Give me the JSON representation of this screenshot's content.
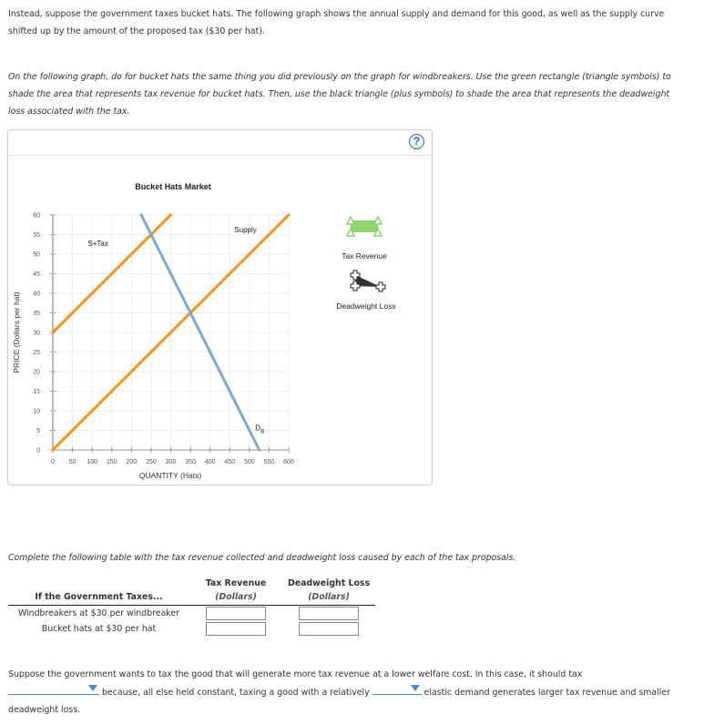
{
  "intro": {
    "paragraph1": "Instead, suppose the government taxes bucket hats. The following graph shows the annual supply and demand for this good, as well as the supply curve shifted up by the amount of the proposed tax ($30 per hat).",
    "paragraph2": "On the following graph, do for bucket hats the same thing you did previously on the graph for windbreakers. Use the green rectangle (triangle symbols) to shade the area that represents tax revenue for bucket hats. Then, use the black triangle (plus symbols) to shade the area that represents the deadweight loss associated with the tax."
  },
  "graph_panel": {
    "help_label": "?",
    "palette": {
      "tax_revenue_label": "Tax Revenue",
      "deadweight_loss_label": "Deadweight Loss",
      "tax_revenue_color": "#8ed36b",
      "deadweight_loss_color": "#333333"
    }
  },
  "chart_data": {
    "type": "line",
    "title": "Bucket Hats Market",
    "xlabel": "QUANTITY (Hats)",
    "ylabel": "PRICE (Dollars per hat)",
    "xlim": [
      0,
      600
    ],
    "ylim": [
      0,
      60
    ],
    "xticks": [
      0,
      50,
      100,
      150,
      200,
      250,
      300,
      350,
      400,
      450,
      500,
      550,
      600
    ],
    "yticks": [
      0,
      5,
      10,
      15,
      20,
      25,
      30,
      35,
      40,
      45,
      50,
      55,
      60
    ],
    "grid": true,
    "series": [
      {
        "name": "S+Tax",
        "label": "S+Tax",
        "color": "#f7941d",
        "points": [
          [
            0,
            30
          ],
          [
            300,
            60
          ]
        ]
      },
      {
        "name": "Supply",
        "label": "Supply",
        "color": "#f7941d",
        "points": [
          [
            0,
            0
          ],
          [
            600,
            60
          ]
        ]
      },
      {
        "name": "Demand",
        "label": "D",
        "label_sub": "B",
        "color": "#7ea9d4",
        "points": [
          [
            225,
            60
          ],
          [
            525,
            0
          ]
        ]
      }
    ]
  },
  "table_section": {
    "instruction": "Complete the following table with the tax revenue collected and deadweight loss caused by each of the tax proposals.",
    "headers": {
      "col1": "If the Government Taxes...",
      "col2_line1": "Tax Revenue",
      "col2_line2": "(Dollars)",
      "col3_line1": "Deadweight Loss",
      "col3_line2": "(Dollars)"
    },
    "rows": [
      {
        "label": "Windbreakers at $30 per windbreaker",
        "tax_revenue": "",
        "deadweight_loss": ""
      },
      {
        "label": "Bucket hats at $30 per hat",
        "tax_revenue": "",
        "deadweight_loss": ""
      }
    ]
  },
  "conclusion": {
    "part1": "Suppose the government wants to tax the good that will generate more tax revenue at a lower welfare cost. In this case, it should tax",
    "dropdown1_value": "",
    "part2": " because, all else held constant, taxing a good with a relatively ",
    "dropdown2_value": "",
    "part3": " elastic demand generates larger tax revenue and smaller deadweight loss."
  }
}
